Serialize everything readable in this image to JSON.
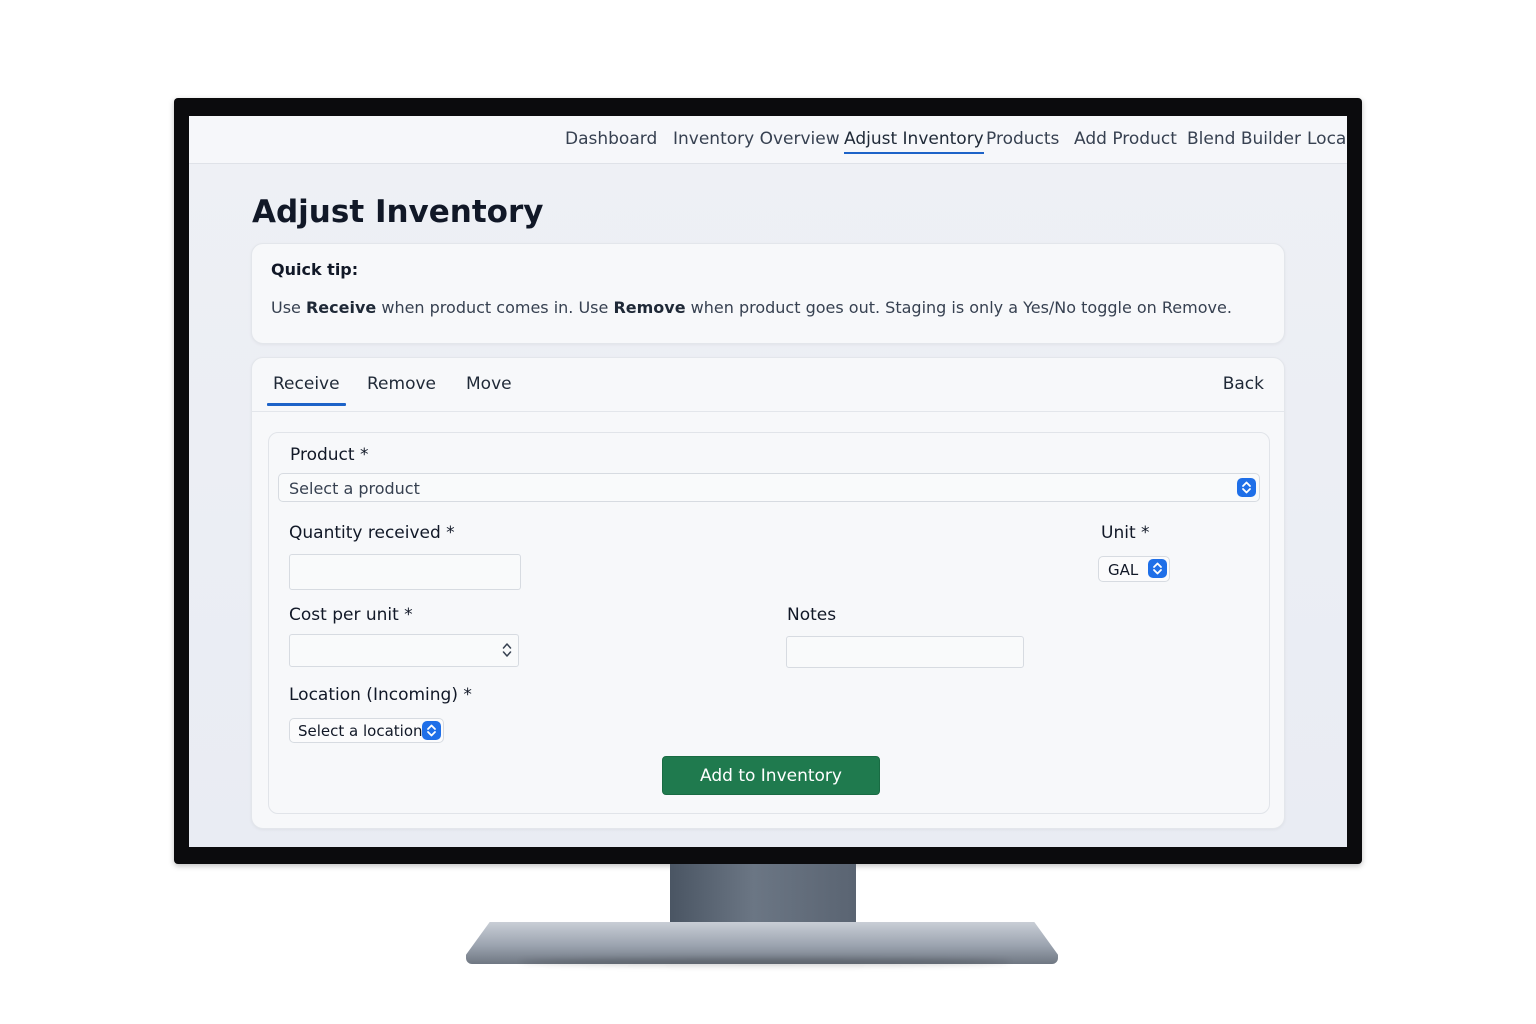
{
  "nav": {
    "items": [
      {
        "label": "Dashboard"
      },
      {
        "label": "Inventory Overview"
      },
      {
        "label": "Adjust Inventory",
        "active": true
      },
      {
        "label": "Products"
      },
      {
        "label": "Add Product"
      },
      {
        "label": "Blend Builder"
      },
      {
        "label": "Loca"
      }
    ]
  },
  "page": {
    "title": "Adjust Inventory"
  },
  "tip": {
    "title": "Quick tip:",
    "text_1": "Use ",
    "bold_1": "Receive",
    "text_2": " when product comes in. Use ",
    "bold_2": "Remove",
    "text_3": " when product goes out. Staging is only a Yes/No toggle on Remove."
  },
  "tabs": {
    "items": [
      {
        "label": "Receive",
        "active": true
      },
      {
        "label": "Remove"
      },
      {
        "label": "Move"
      }
    ],
    "back_label": "Back"
  },
  "form": {
    "product_label": "Product *",
    "product_placeholder": "Select a product",
    "quantity_label": "Quantity received *",
    "quantity_value": "",
    "unit_label": "Unit *",
    "unit_value": "GAL",
    "cost_label": "Cost per unit *",
    "cost_value": "",
    "notes_label": "Notes",
    "notes_value": "",
    "location_label": "Location (Incoming) *",
    "location_placeholder": "Select a location",
    "submit_label": "Add to Inventory"
  },
  "colors": {
    "accent": "#1d63c8",
    "select_spinner": "#1f6fe8",
    "submit_bg": "#1f7a4e"
  },
  "icons": {
    "select_spinner": "chevron-up-down-icon",
    "number_spinner": "number-stepper-icon"
  }
}
